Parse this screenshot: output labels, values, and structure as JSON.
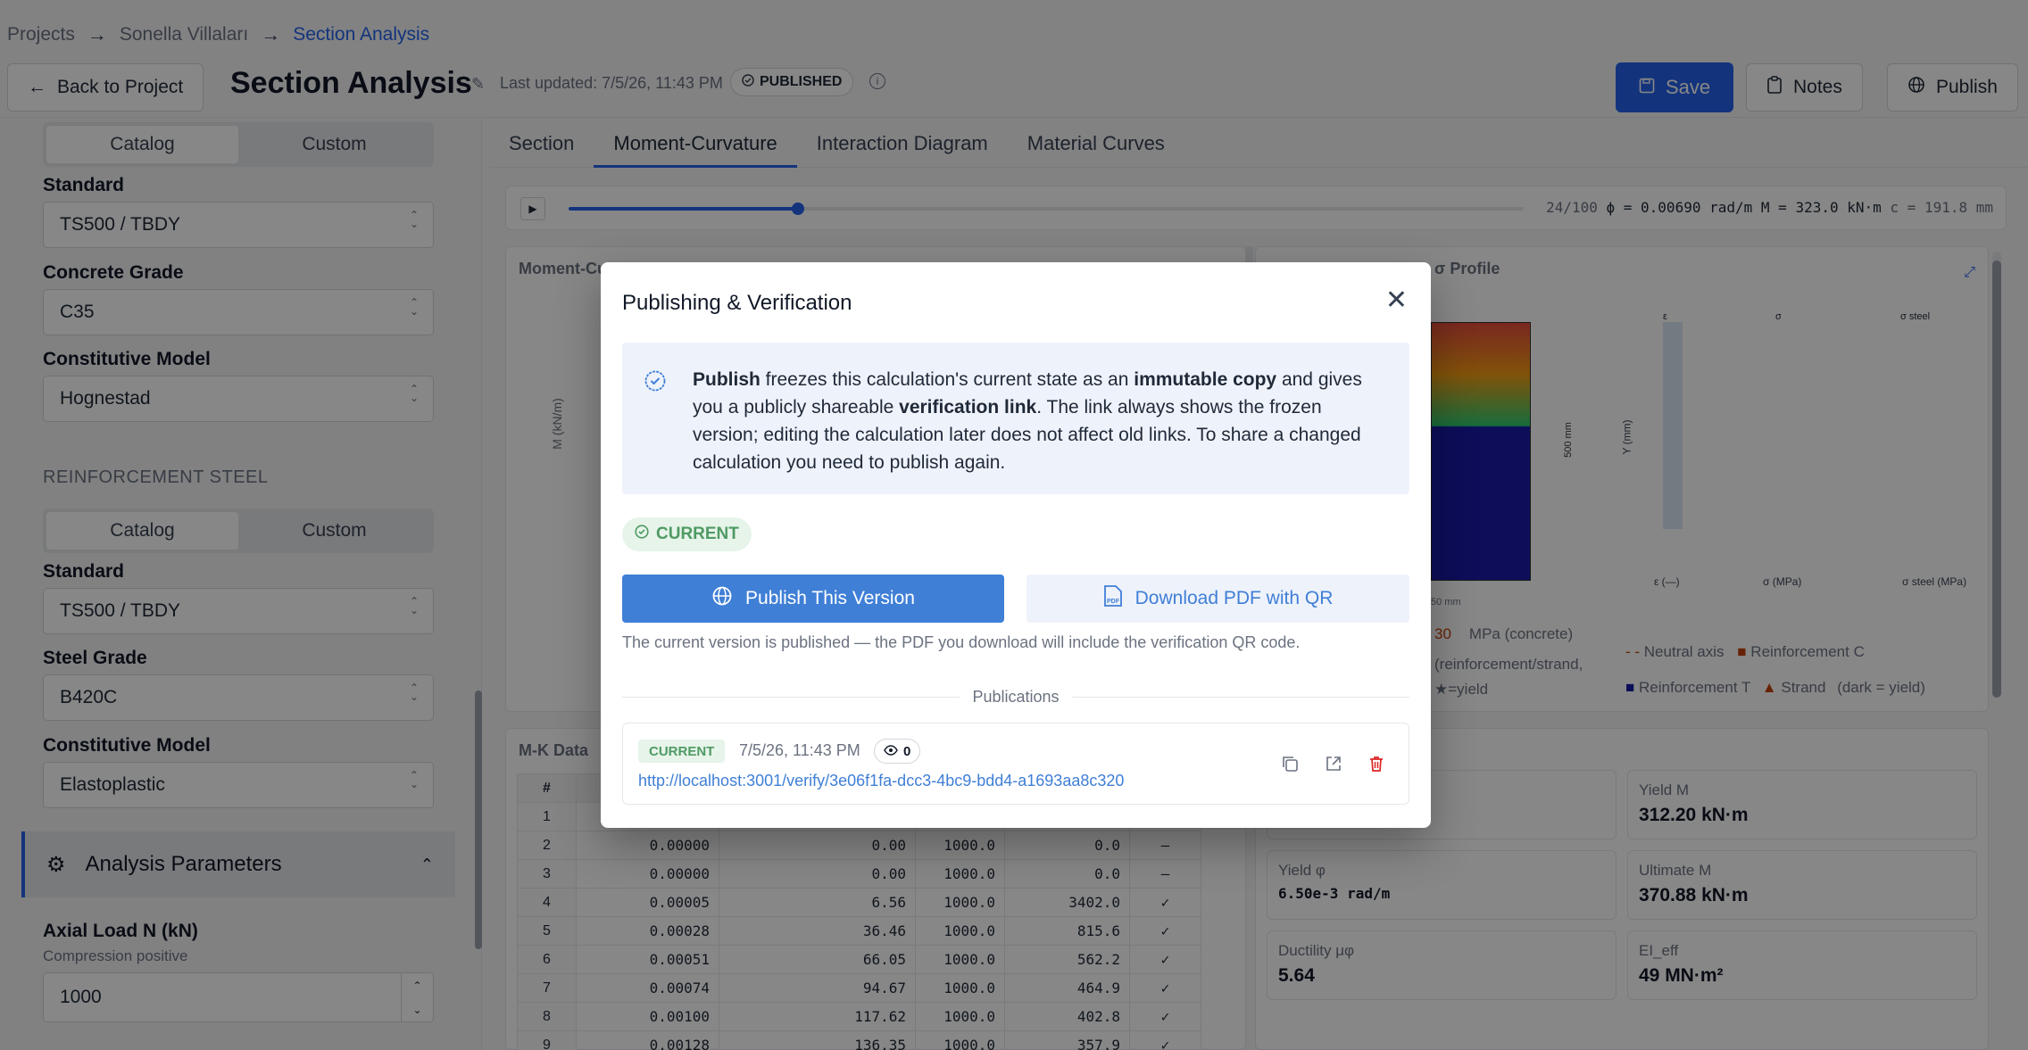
{
  "breadcrumb": {
    "items": [
      "Projects",
      "Sonella Villaları",
      "Section Analysis"
    ],
    "separator": "→"
  },
  "header": {
    "back_label": "Back to Project",
    "title": "Section Analysis",
    "last_updated": "Last updated: 7/5/26, 11:43 PM",
    "status": "PUBLISHED",
    "save_label": "Save",
    "notes_label": "Notes",
    "publish_label": "Publish"
  },
  "sidebar": {
    "concrete_tabs": [
      "Catalog",
      "Custom"
    ],
    "concrete": [
      {
        "label": "Standard",
        "value": "TS500 / TBDY"
      },
      {
        "label": "Concrete Grade",
        "value": "C35"
      },
      {
        "label": "Constitutive Model",
        "value": "Hognestad"
      }
    ],
    "steel_title": "REINFORCEMENT STEEL",
    "steel_tabs": [
      "Catalog",
      "Custom"
    ],
    "steel": [
      {
        "label": "Standard",
        "value": "TS500 / TBDY"
      },
      {
        "label": "Steel Grade",
        "value": "B420C"
      },
      {
        "label": "Constitutive Model",
        "value": "Elastoplastic"
      }
    ],
    "analysis_title": "Analysis Parameters",
    "axial_label": "Axial Load N (kN)",
    "axial_helper": "Compression positive",
    "axial_value": "1000"
  },
  "tabs": [
    "Section",
    "Moment-Curvature",
    "Interaction Diagram",
    "Material Curves"
  ],
  "player": {
    "step": "24/100",
    "phi": "ϕ = 0.00690 rad/m",
    "moment": "M = 323.0 kN·m",
    "c": "c = 191.8 mm",
    "progress": 0.24
  },
  "cards": {
    "mc_title": "Moment-Cu",
    "profile_title": "σ Profile",
    "mk_title": "M-K Data",
    "mk_header": "#",
    "mk_rows": [
      [
        "1",
        "",
        "",
        "",
        "",
        ""
      ],
      [
        "2",
        "0.00000",
        "0.00",
        "1000.0",
        "0.0",
        "—"
      ],
      [
        "3",
        "0.00000",
        "0.00",
        "1000.0",
        "0.0",
        "—"
      ],
      [
        "4",
        "0.00005",
        "6.56",
        "1000.0",
        "3402.0",
        "✓"
      ],
      [
        "5",
        "0.00028",
        "36.46",
        "1000.0",
        "815.6",
        "✓"
      ],
      [
        "6",
        "0.00051",
        "66.05",
        "1000.0",
        "562.2",
        "✓"
      ],
      [
        "7",
        "0.00074",
        "94.67",
        "1000.0",
        "464.9",
        "✓"
      ],
      [
        "8",
        "0.00100",
        "117.62",
        "1000.0",
        "402.8",
        "✓"
      ],
      [
        "9",
        "0.00128",
        "136.35",
        "1000.0",
        "357.9",
        "✓"
      ]
    ],
    "stats": [
      {
        "label": "Yield M",
        "value": "312.20 kN·m"
      },
      {
        "label": "Yield φ",
        "value": "6.50e-3 rad/m"
      },
      {
        "label": "Ultimate M",
        "value": "370.88 kN·m"
      },
      {
        "label": "Ductility μφ",
        "value": "5.64"
      },
      {
        "label": "EI_eff",
        "value": "49 MN·m²"
      }
    ],
    "legend": {
      "neutral_axis": "Neutral axis",
      "reinf_c": "Reinforcement C",
      "reinf_t": "Reinforcement T",
      "strand": "Strand",
      "dark_yield": "(dark = yield)",
      "mpa_concrete": "MPa (concrete)",
      "mpa_value": "30",
      "reinf_note": "(reinforcement/strand,",
      "star_note": "★=yield"
    },
    "profile_labels": {
      "eps": "ε",
      "sigma": "σ",
      "sigma_steel": "σ steel",
      "x_eps": "ε (—)",
      "x_sigma": "σ (MPa)",
      "x_steel": "σ steel (MPa)",
      "y_axis": "Y (mm)",
      "dim": "500 mm",
      "dim_b": "50 mm",
      "m_axis": "M (kN/m)"
    }
  },
  "modal": {
    "title": "Publishing & Verification",
    "info_parts": [
      {
        "t": "Publish",
        "b": true
      },
      {
        "t": " freezes this calculation's current state as an ",
        "b": false
      },
      {
        "t": "immutable copy",
        "b": true
      },
      {
        "t": " and gives you a publicly shareable ",
        "b": false
      },
      {
        "t": "verification link",
        "b": true
      },
      {
        "t": ". The link always shows the frozen version; editing the calculation later does not affect old links. To share a changed calculation you need to publish again.",
        "b": false
      }
    ],
    "current_chip": "CURRENT",
    "publish_label": "Publish This Version",
    "pdf_label": "Download PDF with QR",
    "note": "The current version is published — the PDF you download will include the verification QR code.",
    "publications_label": "Publications",
    "publication": {
      "status": "CURRENT",
      "date": "7/5/26, 11:43 PM",
      "views": "0",
      "url": "http://localhost:3001/verify/3e06f1fa-dcc3-4bc9-bdd4-a1693aa8c320"
    },
    "accent": "#3f7fd6",
    "success": "#4f9a63",
    "danger": "#dc2626"
  }
}
